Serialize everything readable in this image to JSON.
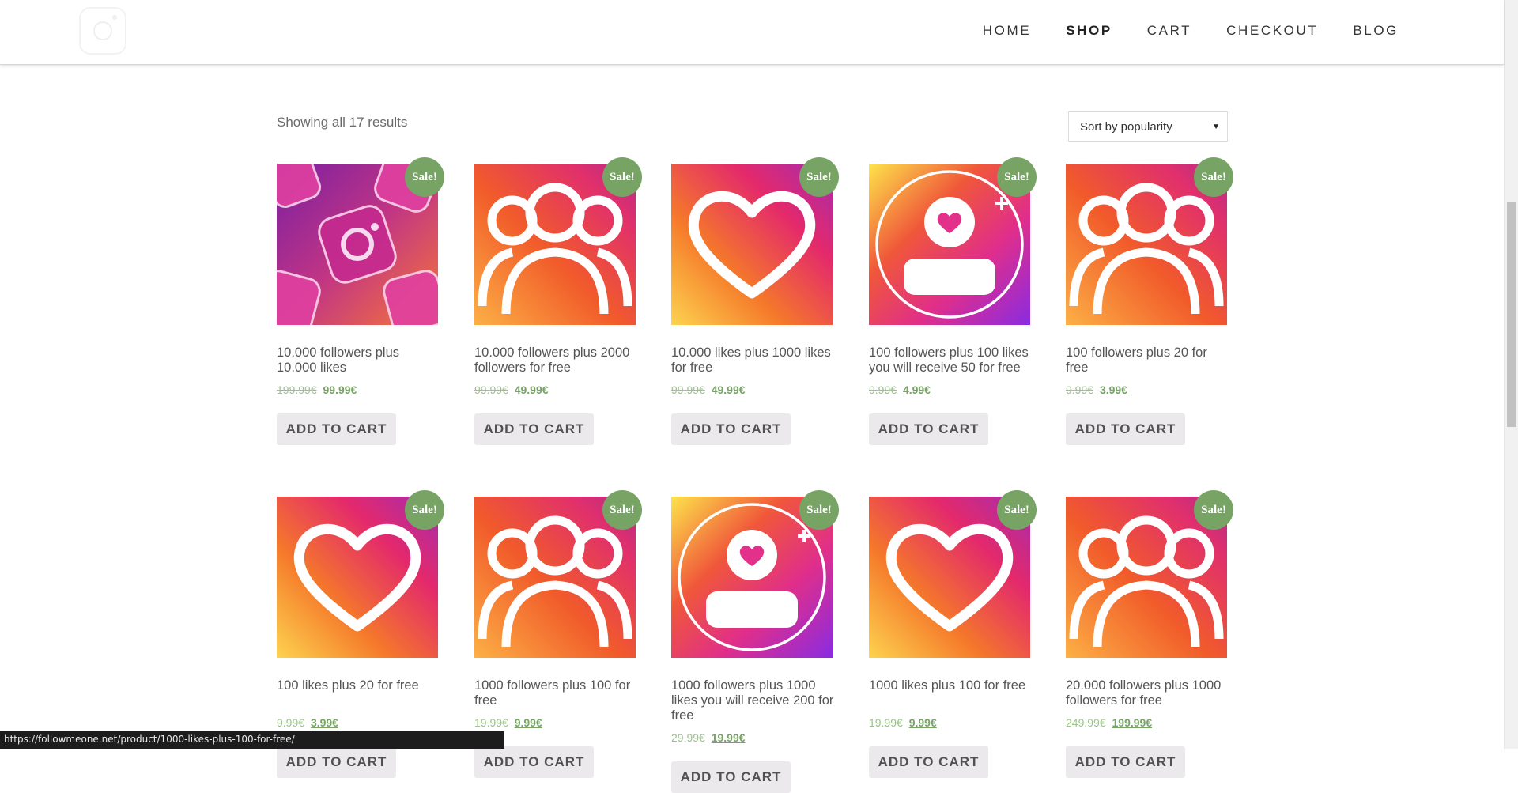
{
  "nav": {
    "items": [
      "HOME",
      "SHOP",
      "CART",
      "CHECKOUT",
      "BLOG"
    ],
    "active": "SHOP"
  },
  "shop": {
    "results_text": "Showing all 17 results",
    "sort_selected": "Sort by popularity"
  },
  "sale_badge": "Sale!",
  "add_to_cart_label": "ADD TO CART",
  "products": [
    {
      "title": "10.000 followers plus 10.000 likes",
      "old_price": "199.99€",
      "new_price": "99.99€",
      "image": "instagram-logos-image"
    },
    {
      "title": "10.000 followers plus 2000 followers for free",
      "old_price": "99.99€",
      "new_price": "49.99€",
      "image": "followers-icon"
    },
    {
      "title": "10.000 likes plus 1000 likes for free",
      "old_price": "99.99€",
      "new_price": "49.99€",
      "image": "heart-icon"
    },
    {
      "title": "100 followers plus 100 likes you will receive 50 for free",
      "old_price": "9.99€",
      "new_price": "4.99€",
      "image": "profile-like-icon"
    },
    {
      "title": "100 followers plus 20 for free",
      "old_price": "9.99€",
      "new_price": "3.99€",
      "image": "followers-icon"
    },
    {
      "title": "100 likes plus 20 for free",
      "old_price": "9.99€",
      "new_price": "3.99€",
      "image": "heart-icon"
    },
    {
      "title": "1000 followers plus 100 for free",
      "old_price": "19.99€",
      "new_price": "9.99€",
      "image": "followers-icon"
    },
    {
      "title": "1000 followers plus 1000 likes you will receive 200 for free",
      "old_price": "29.99€",
      "new_price": "19.99€",
      "image": "profile-like-icon"
    },
    {
      "title": "1000 likes plus 100 for free",
      "old_price": "19.99€",
      "new_price": "9.99€",
      "image": "heart-icon"
    },
    {
      "title": "20.000 followers plus 1000 followers for free",
      "old_price": "249.99€",
      "new_price": "199.99€",
      "image": "followers-icon"
    }
  ],
  "status_url": "https://followmeone.net/product/1000-likes-plus-100-for-free/",
  "colors": {
    "sale_badge": "#77a464",
    "price": "#77a464",
    "button_bg": "#ebe9eb"
  }
}
